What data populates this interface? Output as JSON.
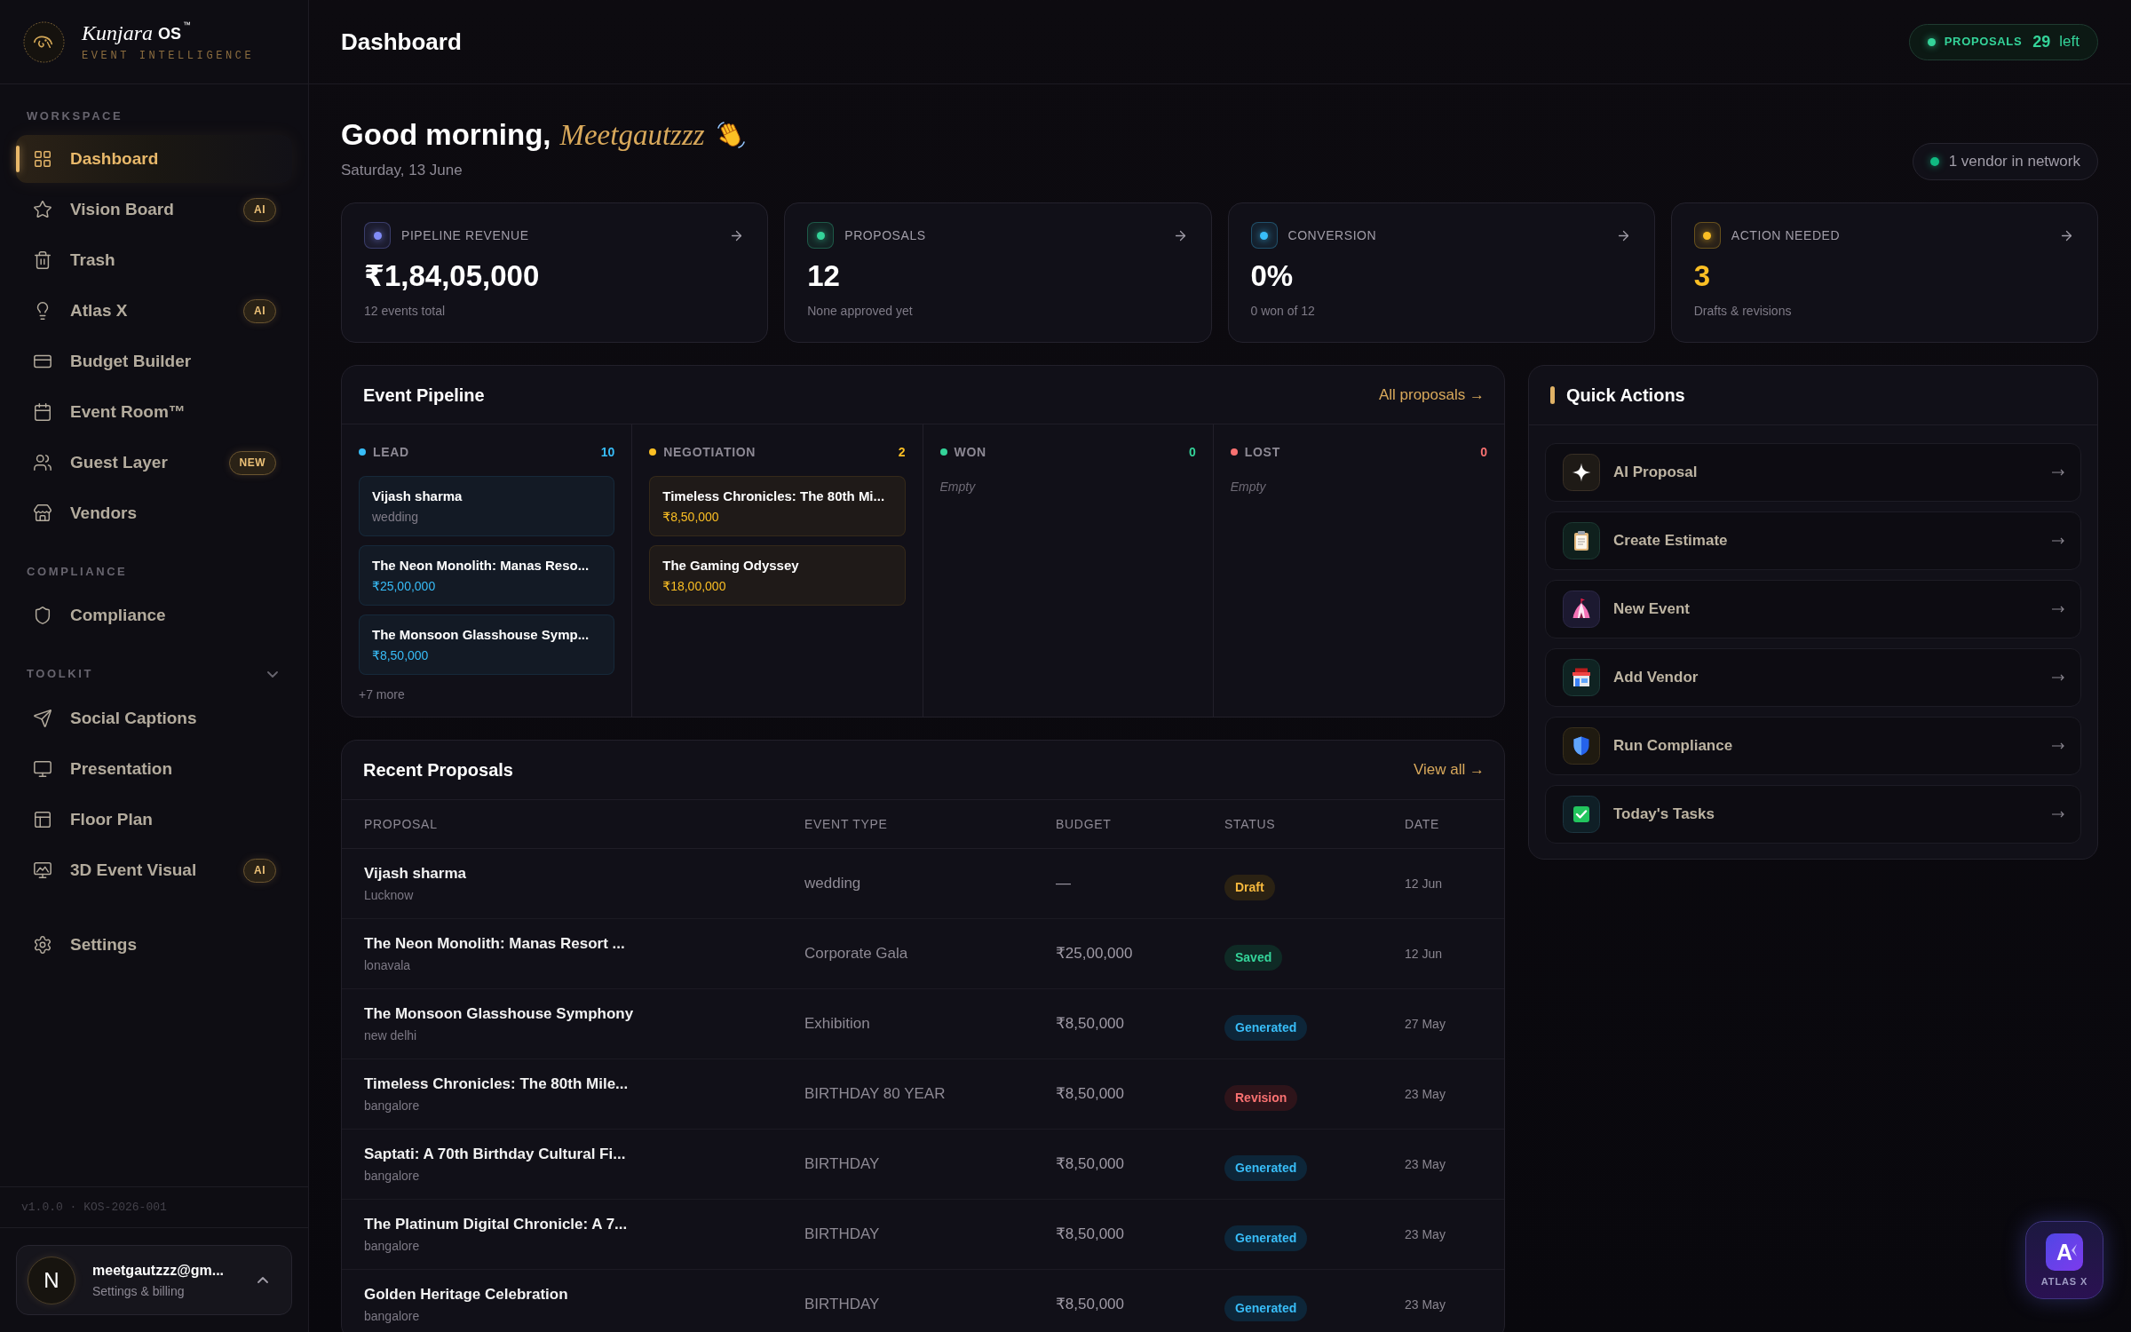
{
  "sidebar": {
    "brand": {
      "name": "Kunjara",
      "suffix": "OS",
      "mark": "™",
      "tagline": "EVENT INTELLIGENCE"
    },
    "workspace": {
      "title": "WORKSPACE",
      "items": [
        {
          "label": "Dashboard",
          "selected": true
        },
        {
          "label": "Vision Board",
          "selected": false,
          "badge": "AI"
        },
        {
          "label": "Trash",
          "selected": false
        },
        {
          "label": "Atlas X",
          "selected": false,
          "badge": "AI"
        },
        {
          "label": "Budget Builder",
          "selected": false
        },
        {
          "label": "Event Room™",
          "selected": false
        },
        {
          "label": "Guest Layer",
          "selected": false,
          "badge": "NEW"
        },
        {
          "label": "Vendors",
          "selected": false
        }
      ]
    },
    "compliance": {
      "title": "COMPLIANCE",
      "items": [
        {
          "label": "Compliance",
          "selected": false
        }
      ]
    },
    "toolkit": {
      "title": "TOOLKIT",
      "expanded": true,
      "items": [
        {
          "label": "Social Captions",
          "selected": false
        },
        {
          "label": "Presentation",
          "selected": false
        },
        {
          "label": "Floor Plan",
          "selected": false
        },
        {
          "label": "3D Event Visual",
          "selected": false,
          "badge": "AI"
        }
      ]
    },
    "settings": {
      "label": "Settings",
      "selected": false
    },
    "version": "v1.0.0 · KOS-2026-001",
    "user": {
      "initial": "N",
      "email": "meetgautzzz@gm...",
      "subtitle": "Settings & billing"
    }
  },
  "header": {
    "title": "Dashboard",
    "quota": {
      "label": "PROPOSALS",
      "count": "29",
      "suffix": "left"
    }
  },
  "greeting": {
    "text": "Good morning,",
    "name": "Meetgautzzz",
    "date": "Saturday, 13 June",
    "network": "1 vendor in network"
  },
  "stats": [
    {
      "label": "PIPELINE REVENUE",
      "value": "₹1,84,05,000",
      "note": "12 events total",
      "color": "#818cf8",
      "highlighted": false
    },
    {
      "label": "PROPOSALS",
      "value": "12",
      "note": "None approved yet",
      "color": "#34d399",
      "highlighted": false
    },
    {
      "label": "CONVERSION",
      "value": "0%",
      "note": "0 won of 12",
      "color": "#38bdf8",
      "highlighted": false
    },
    {
      "label": "ACTION NEEDED",
      "value": "3",
      "note": "Drafts & revisions",
      "color": "#fbbf24",
      "highlighted": true
    }
  ],
  "pipeline": {
    "title": "Event Pipeline",
    "link": "All proposals →",
    "columns": [
      {
        "label": "LEAD",
        "count": "10",
        "color": "#38bdf8",
        "cards": [
          {
            "title": "Vijash sharma",
            "subtitle": "wedding",
            "kind": "category"
          },
          {
            "title": "The Neon Monolith: Manas Reso...",
            "subtitle": "₹25,00,000",
            "kind": "amount"
          },
          {
            "title": "The Monsoon Glasshouse Symp...",
            "subtitle": "₹8,50,000",
            "kind": "amount"
          }
        ],
        "more": "+7 more"
      },
      {
        "label": "NEGOTIATION",
        "count": "2",
        "color": "#fbbf24",
        "cards": [
          {
            "title": "Timeless Chronicles: The 80th Mi...",
            "subtitle": "₹8,50,000",
            "kind": "amount"
          },
          {
            "title": "The Gaming Odyssey",
            "subtitle": "₹18,00,000",
            "kind": "amount"
          }
        ]
      },
      {
        "label": "WON",
        "count": "0",
        "color": "#34d399",
        "empty": "Empty"
      },
      {
        "label": "LOST",
        "count": "0",
        "color": "#f87171",
        "empty": "Empty"
      }
    ]
  },
  "quick_actions": {
    "title": "Quick Actions",
    "items": [
      {
        "label": "AI Proposal"
      },
      {
        "label": "Create Estimate"
      },
      {
        "label": "New Event"
      },
      {
        "label": "Add Vendor"
      },
      {
        "label": "Run Compliance"
      },
      {
        "label": "Today's Tasks"
      }
    ]
  },
  "recent_proposals": {
    "title": "Recent Proposals",
    "link": "View all →",
    "columns": [
      "PROPOSAL",
      "EVENT TYPE",
      "BUDGET",
      "STATUS",
      "DATE"
    ],
    "rows": [
      {
        "title": "Vijash sharma",
        "location": "Lucknow",
        "event_type": "wedding",
        "budget": "—",
        "status": {
          "label": "Draft",
          "kind": "draft"
        },
        "date": "12 Jun"
      },
      {
        "title": "The Neon Monolith: Manas Resort ...",
        "location": "lonavala",
        "event_type": "Corporate Gala",
        "budget": "₹25,00,000",
        "status": {
          "label": "Saved",
          "kind": "saved"
        },
        "date": "12 Jun"
      },
      {
        "title": "The Monsoon Glasshouse Symphony",
        "location": "new delhi",
        "event_type": "Exhibition",
        "budget": "₹8,50,000",
        "status": {
          "label": "Generated",
          "kind": "generated"
        },
        "date": "27 May"
      },
      {
        "title": "Timeless Chronicles: The 80th Mile...",
        "location": "bangalore",
        "event_type": "BIRTHDAY 80 YEAR",
        "budget": "₹8,50,000",
        "status": {
          "label": "Revision",
          "kind": "revision"
        },
        "date": "23 May"
      },
      {
        "title": "Saptati: A 70th Birthday Cultural Fi...",
        "location": "bangalore",
        "event_type": "BIRTHDAY",
        "budget": "₹8,50,000",
        "status": {
          "label": "Generated",
          "kind": "generated"
        },
        "date": "23 May"
      },
      {
        "title": "The Platinum Digital Chronicle: A 7...",
        "location": "bangalore",
        "event_type": "BIRTHDAY",
        "budget": "₹8,50,000",
        "status": {
          "label": "Generated",
          "kind": "generated"
        },
        "date": "23 May"
      },
      {
        "title": "Golden Heritage Celebration",
        "location": "bangalore",
        "event_type": "BIRTHDAY",
        "budget": "₹8,50,000",
        "status": {
          "label": "Generated",
          "kind": "generated"
        },
        "date": "23 May"
      }
    ]
  },
  "assistant_button": {
    "letter": "A",
    "label": "ATLAS X"
  }
}
